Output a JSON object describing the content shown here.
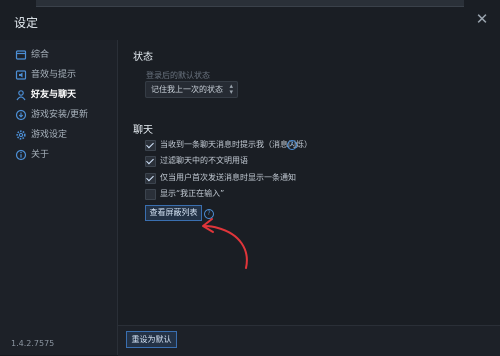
{
  "window": {
    "title": "设定",
    "close_glyph": "✕"
  },
  "sidebar": {
    "items": [
      {
        "label": "综合",
        "icon": "window-icon",
        "active": false
      },
      {
        "label": "音效与提示",
        "icon": "speaker-icon",
        "active": false
      },
      {
        "label": "好友与聊天",
        "icon": "person-icon",
        "active": true
      },
      {
        "label": "游戏安装/更新",
        "icon": "download-icon",
        "active": false
      },
      {
        "label": "游戏设定",
        "icon": "gear-icon",
        "active": false
      },
      {
        "label": "关于",
        "icon": "info-icon",
        "active": false
      }
    ],
    "version": "1.4.2.7575"
  },
  "status": {
    "heading": "状态",
    "default_label": "登录后的默认状态",
    "select_value": "记住我上一次的状态"
  },
  "chat": {
    "heading": "聊天",
    "options": [
      {
        "label": "当收到一条聊天消息时提示我（消息闪烁）",
        "checked": true,
        "help": true
      },
      {
        "label": "过滤聊天中的不文明用语",
        "checked": true,
        "help": false
      },
      {
        "label": "仅当用户首次发送消息时显示一条通知",
        "checked": true,
        "help": false
      },
      {
        "label": "显示“我正在输入”",
        "checked": false,
        "help": false
      }
    ],
    "blocklist_button": "查看屏蔽列表"
  },
  "footer": {
    "reset_button": "重设为默认"
  },
  "colors": {
    "accent": "#3a6fb0",
    "annotation_arrow": "#e0353a"
  }
}
